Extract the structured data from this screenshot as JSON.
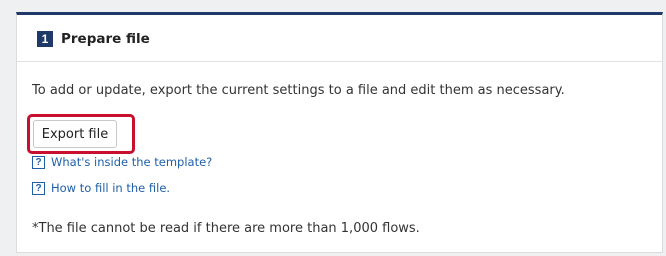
{
  "section": {
    "step_number": "1",
    "title": "Prepare file",
    "description": "To add or update, export the current settings to a file and edit them as necessary.",
    "export_button_label": "Export file",
    "links": [
      {
        "icon": "help-icon",
        "label": "What's inside the template?"
      },
      {
        "icon": "help-icon",
        "label": "How to fill in the file."
      }
    ],
    "help_icon_glyph": "?",
    "note": "*The file cannot be read if there are more than 1,000 flows."
  },
  "colors": {
    "header_accent": "#1f3a68",
    "highlight": "#c8102e",
    "link": "#1f5fa8"
  }
}
